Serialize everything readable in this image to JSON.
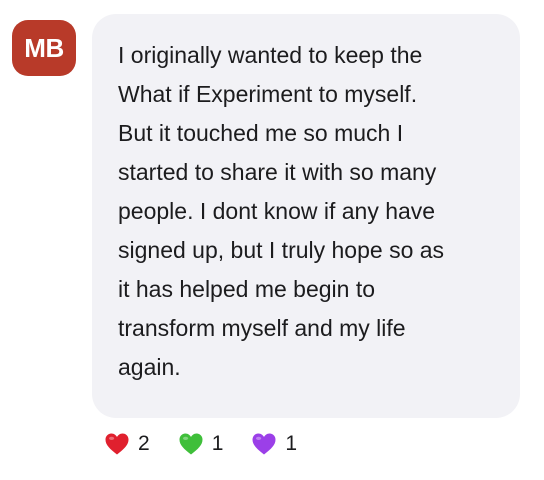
{
  "author": {
    "initials": "MB",
    "avatar_color": "#b83a29"
  },
  "message": {
    "text": "I originally wanted to keep the\nWhat if Experiment to myself.\nBut it touched me so much I\nstarted to share it with so many\npeople. I dont know if any have\nsigned up, but I truly hope so as\nit has helped me begin to\ntransform myself and my life\nagain."
  },
  "reactions": [
    {
      "icon": "red-heart-icon",
      "color": "#e0202e",
      "count": "2"
    },
    {
      "icon": "green-heart-icon",
      "color": "#3fbf3a",
      "count": "1"
    },
    {
      "icon": "purple-heart-icon",
      "color": "#9b3fe8",
      "count": "1"
    }
  ]
}
